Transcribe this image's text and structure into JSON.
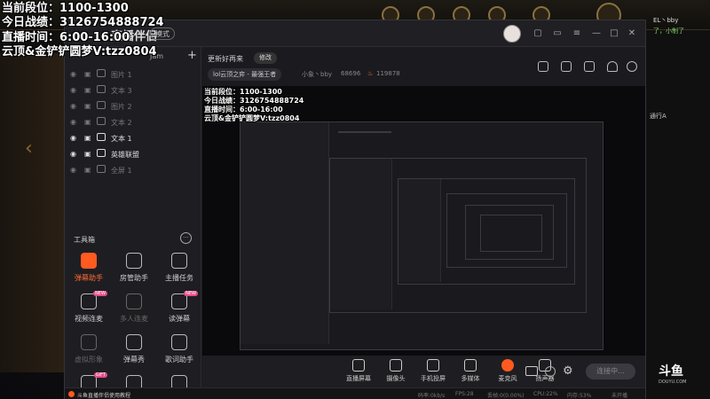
{
  "overlay": {
    "line1": "当前段位：1100-1300",
    "line2": "今日战绩：3126754888724",
    "line3": "直播时间：6:00-16:00",
    "line4": "云顶&金铲铲圆梦V:tzz0804"
  },
  "background_chat": [
    "EL丶bby",
    "了，小制了",
    "通行A"
  ],
  "app": {
    "logo": "直播伴侣",
    "mode": "模式",
    "scene_name": "Jam"
  },
  "layers": [
    {
      "label": "图片 1",
      "visible": false
    },
    {
      "label": "文本 3",
      "visible": false
    },
    {
      "label": "图片 2",
      "visible": false
    },
    {
      "label": "文本 2",
      "visible": false
    },
    {
      "label": "文本 1",
      "visible": true
    },
    {
      "label": "英雄联盟",
      "visible": true
    },
    {
      "label": "全屏 1",
      "visible": false
    }
  ],
  "toolbox": {
    "title": "工具箱",
    "more": "···",
    "tools": [
      {
        "label": "弹幕助手",
        "active": true,
        "dim": false,
        "badge": ""
      },
      {
        "label": "房管助手",
        "active": false,
        "dim": false,
        "badge": ""
      },
      {
        "label": "主播任务",
        "active": false,
        "dim": false,
        "badge": ""
      },
      {
        "label": "视频连麦",
        "active": false,
        "dim": false,
        "badge": "NEW"
      },
      {
        "label": "多人连麦",
        "active": false,
        "dim": true,
        "badge": ""
      },
      {
        "label": "读弹幕",
        "active": false,
        "dim": false,
        "badge": "NEW"
      },
      {
        "label": "虚拟形象",
        "active": false,
        "dim": true,
        "badge": ""
      },
      {
        "label": "弹幕秀",
        "active": false,
        "dim": false,
        "badge": ""
      },
      {
        "label": "歌词助手",
        "active": false,
        "dim": false,
        "badge": ""
      },
      {
        "label": "",
        "active": false,
        "dim": false,
        "badge": "GIFT"
      },
      {
        "label": "",
        "active": false,
        "dim": false,
        "badge": ""
      },
      {
        "label": "",
        "active": false,
        "dim": false,
        "badge": ""
      }
    ]
  },
  "header": {
    "title": "更新好再来",
    "edit": "修改",
    "category": "lol云顶之弈 - 最强王者",
    "user": "小象丶bby",
    "room_id": "68696",
    "hot": "119878"
  },
  "bottom": {
    "buttons": [
      {
        "label": "直播屏幕",
        "key": "screen"
      },
      {
        "label": "摄像头",
        "key": "camera"
      },
      {
        "label": "手机投屏",
        "key": "phone"
      },
      {
        "label": "多媒体",
        "key": "media"
      },
      {
        "label": "麦克风",
        "key": "mic"
      },
      {
        "label": "扬声器",
        "key": "speaker"
      }
    ],
    "live": "连接中..."
  },
  "status": {
    "tutorial": "斗鱼直播伴侣使用教程",
    "bitrate": "码率:0kb/s",
    "fps": "FPS:28",
    "drop": "丢帧:0(0.00%)",
    "cpu": "CPU:22%",
    "mem": "内存:53%",
    "open": "未开播"
  },
  "brand": {
    "logo": "斗鱼",
    "sub": "DOUYU.COM"
  }
}
